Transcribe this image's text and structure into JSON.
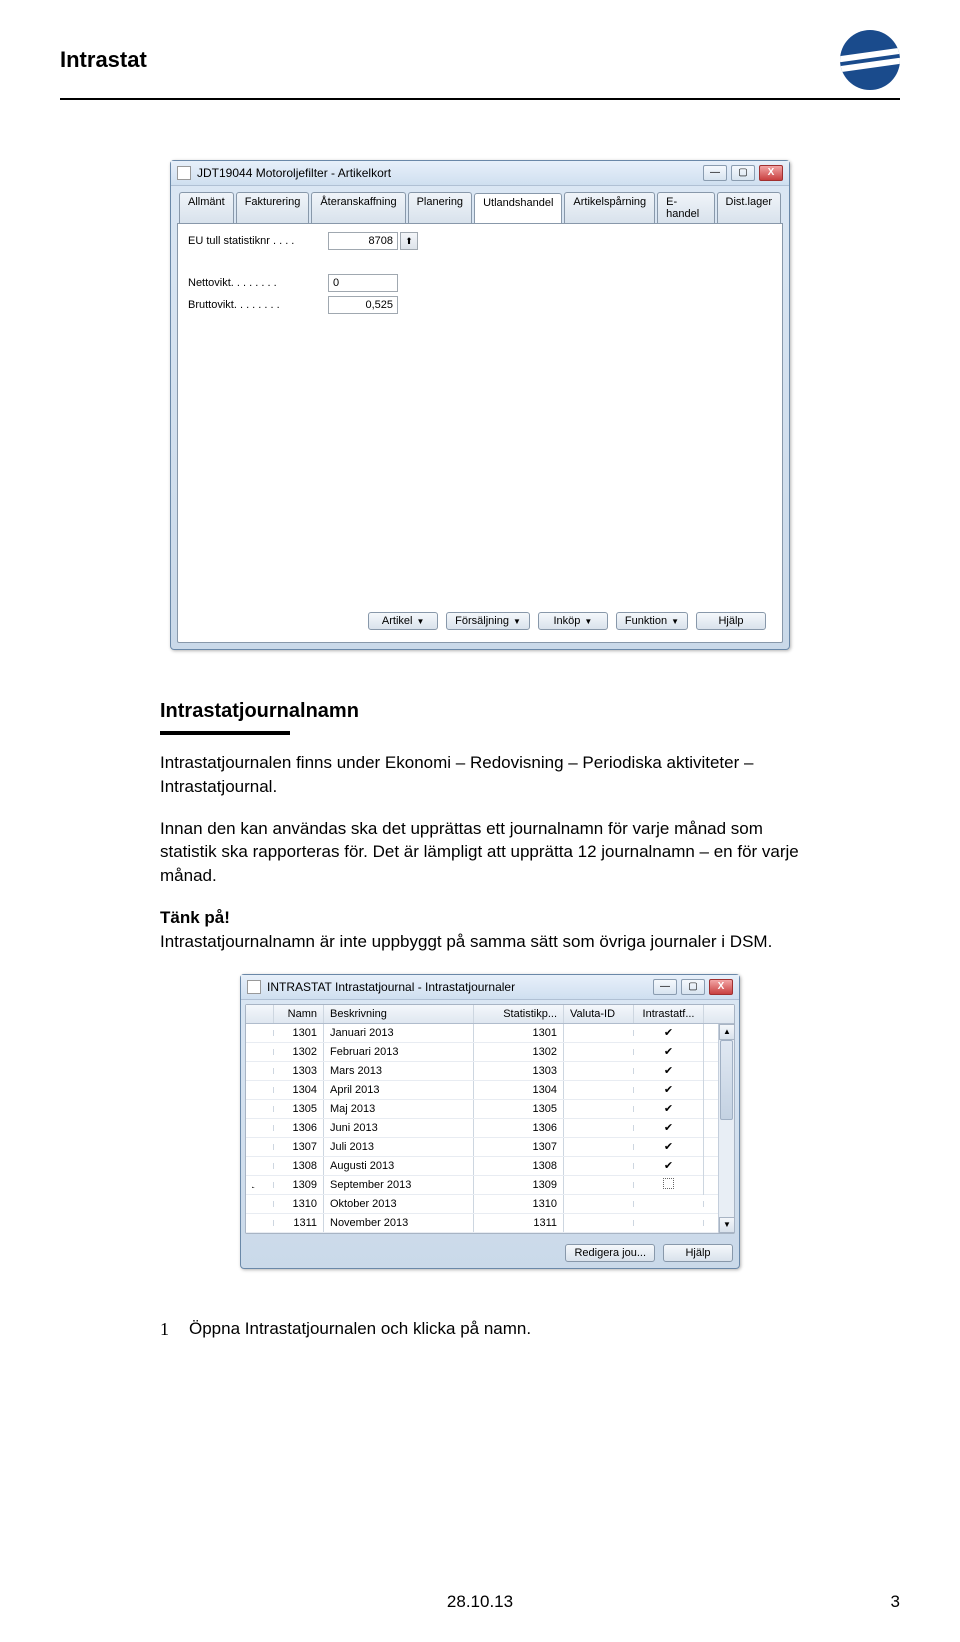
{
  "header": {
    "title": "Intrastat"
  },
  "win1": {
    "title": "JDT19044 Motoroljefilter - Artikelkort",
    "controls": {
      "min": "—",
      "max": "▢",
      "close": "X"
    },
    "tabs": [
      "Allmänt",
      "Fakturering",
      "Återanskaffning",
      "Planering",
      "Utlandshandel",
      "Artikelspårning",
      "E-handel",
      "Dist.lager"
    ],
    "active_tab_index": 4,
    "fields": {
      "eu_label": "EU tull statistiknr . . . .",
      "eu_value": "8708",
      "netto_label": "Nettovikt. . . . . . . .",
      "netto_value": "0",
      "brutto_label": "Bruttovikt. . . . . . . .",
      "brutto_value": "0,525"
    },
    "buttons": [
      "Artikel",
      "Försäljning",
      "Inköp",
      "Funktion",
      "Hjälp"
    ]
  },
  "body": {
    "heading": "Intrastatjournalnamn",
    "p1": "Intrastatjournalen finns under Ekonomi – Redovisning – Periodiska aktiviteter – Intrastatjournal.",
    "p2": "Innan den kan användas ska det upprättas ett journalnamn för varje månad som statistik ska rapporteras för. Det är lämpligt att upprätta 12 journalnamn – en för varje månad.",
    "p3_bold": "Tänk på!",
    "p3": "Intrastatjournalnamn är inte uppbyggt på samma sätt som övriga journaler i DSM.",
    "step_num": "1",
    "step_text": "Öppna Intrastatjournalen och klicka på namn."
  },
  "win2": {
    "title": "INTRASTAT Intrastatjournal - Intrastatjournaler",
    "controls": {
      "min": "—",
      "max": "▢",
      "close": "X"
    },
    "columns": [
      "Namn",
      "Beskrivning",
      "Statistikp...",
      "Valuta-ID",
      "Intrastatf..."
    ],
    "rows": [
      {
        "namn": "1301",
        "beskr": "Januari 2013",
        "stat": "1301",
        "valuta": "",
        "checked": true,
        "pointer": false
      },
      {
        "namn": "1302",
        "beskr": "Februari 2013",
        "stat": "1302",
        "valuta": "",
        "checked": true,
        "pointer": false
      },
      {
        "namn": "1303",
        "beskr": "Mars 2013",
        "stat": "1303",
        "valuta": "",
        "checked": true,
        "pointer": false
      },
      {
        "namn": "1304",
        "beskr": "April 2013",
        "stat": "1304",
        "valuta": "",
        "checked": true,
        "pointer": false
      },
      {
        "namn": "1305",
        "beskr": "Maj 2013",
        "stat": "1305",
        "valuta": "",
        "checked": true,
        "pointer": false
      },
      {
        "namn": "1306",
        "beskr": "Juni 2013",
        "stat": "1306",
        "valuta": "",
        "checked": true,
        "pointer": false
      },
      {
        "namn": "1307",
        "beskr": "Juli 2013",
        "stat": "1307",
        "valuta": "",
        "checked": true,
        "pointer": false
      },
      {
        "namn": "1308",
        "beskr": "Augusti 2013",
        "stat": "1308",
        "valuta": "",
        "checked": true,
        "pointer": false
      },
      {
        "namn": "1309",
        "beskr": "September 2013",
        "stat": "1309",
        "valuta": "",
        "checked": false,
        "pointer": true
      },
      {
        "namn": "1310",
        "beskr": "Oktober 2013",
        "stat": "1310",
        "valuta": "",
        "checked": false,
        "pointer": false
      },
      {
        "namn": "1311",
        "beskr": "November 2013",
        "stat": "1311",
        "valuta": "",
        "checked": false,
        "pointer": false
      }
    ],
    "buttons": [
      "Redigera jou...",
      "Hjälp"
    ]
  },
  "footer": {
    "date": "28.10.13",
    "page": "3"
  }
}
